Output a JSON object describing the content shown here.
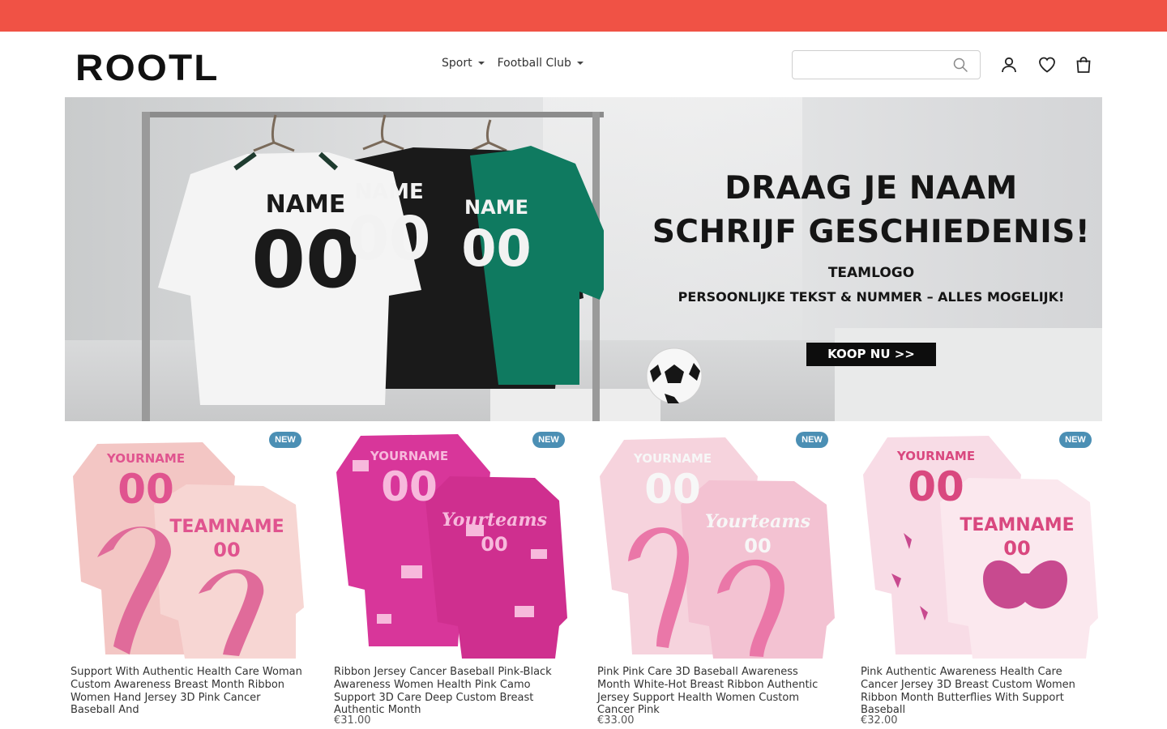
{
  "brand": {
    "logo": "ROOTL"
  },
  "nav": {
    "items": [
      {
        "label": "Sport"
      },
      {
        "label": "Football Club"
      }
    ]
  },
  "search": {
    "placeholder": ""
  },
  "hero": {
    "jersey_name": "NAME",
    "jersey_number": "00",
    "headline_1": "DRAAG JE NAAM",
    "headline_2": "SCHRIJF GESCHIEDENIS!",
    "sub_1": "TEAMLOGO",
    "sub_2": "PERSOONLIJKE TEKST & NUMMER – ALLES MOGELIJK!",
    "cta": "KOOP NU >>"
  },
  "products": [
    {
      "badge": "NEW",
      "print_name": "YOURNAME",
      "print_number": "00",
      "print_team": "TEAMNAME",
      "title": "Support With Authentic Health Care Woman Custom Awareness Breast Month Ribbon Women Hand Jersey 3D Pink Cancer Baseball And",
      "price": "",
      "colors": {
        "base": "#f5c9c9",
        "accent": "#e0548f"
      }
    },
    {
      "badge": "NEW",
      "print_name": "YOURNAME",
      "print_number": "00",
      "print_team": "Yourteams",
      "title": "Ribbon Jersey Cancer Baseball Pink-Black Awareness Women Health Pink Camo Support 3D Care Deep Custom Breast Authentic Month",
      "price": "€31.00",
      "colors": {
        "base": "#d8369a",
        "accent": "#f7b9dc"
      }
    },
    {
      "badge": "NEW",
      "print_name": "YOURNAME",
      "print_number": "00",
      "print_team": "Yourteams",
      "title": "Pink Pink Care 3D Baseball Awareness Month White-Hot Breast Ribbon Authentic Jersey Support Health Women Custom Cancer Pink",
      "price": "€33.00",
      "colors": {
        "base": "#f6d3dd",
        "accent": "#ea77a8"
      }
    },
    {
      "badge": "NEW",
      "print_name": "YOURNAME",
      "print_number": "00",
      "print_team": "TEAMNAME",
      "title": "Pink Authentic Awareness Health Care Cancer Jersey 3D Breast Custom Women Ribbon Month Butterflies With Support Baseball",
      "price": "€32.00",
      "colors": {
        "base": "#f8dce6",
        "accent": "#d9487f"
      }
    }
  ],
  "colors": {
    "top_bar": "#f05245",
    "badge": "#4b8fb4",
    "cta_bg": "#0d0d0d"
  }
}
